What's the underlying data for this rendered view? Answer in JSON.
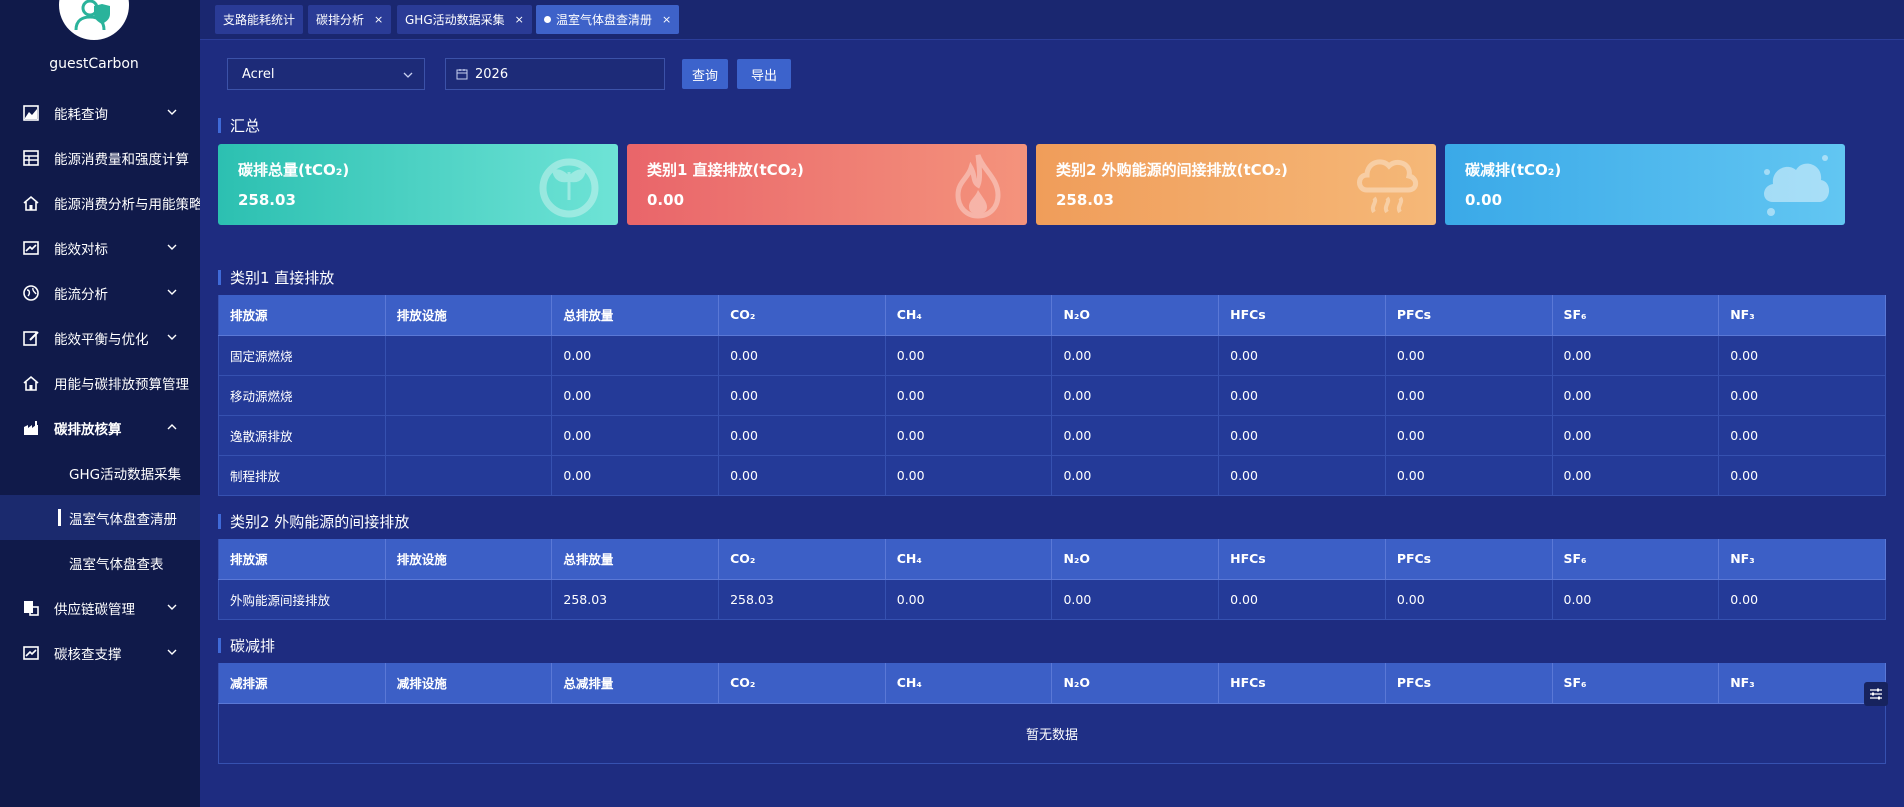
{
  "user": {
    "name": "guestCarbon"
  },
  "menu": [
    {
      "label": "能耗查询",
      "icon": "chart-area-icon",
      "has_chevron": true
    },
    {
      "label": "能源消费量和强度计算",
      "icon": "table-icon",
      "has_chevron": false
    },
    {
      "label": "能源消费分析与用能策略",
      "icon": "home-icon",
      "has_chevron": false
    },
    {
      "label": "能效对标",
      "icon": "trend-icon",
      "has_chevron": true
    },
    {
      "label": "能流分析",
      "icon": "globe-icon",
      "has_chevron": true
    },
    {
      "label": "能效平衡与优化",
      "icon": "edit-icon",
      "has_chevron": true
    },
    {
      "label": "用能与碳排放预算管理",
      "icon": "home-icon",
      "has_chevron": false
    },
    {
      "label": "碳排放核算",
      "icon": "factory-icon",
      "has_chevron": true
    }
  ],
  "submenu": [
    {
      "label": "GHG活动数据采集"
    },
    {
      "label": "温室气体盘查清册"
    },
    {
      "label": "温室气体盘查表"
    }
  ],
  "menu_bottom": [
    {
      "label": "供应链碳管理",
      "icon": "supply-chain-icon"
    },
    {
      "label": "碳核查支撑",
      "icon": "trend-icon"
    }
  ],
  "tabs": [
    {
      "label": "支路能耗统计",
      "closable": false
    },
    {
      "label": "碳排分析",
      "closable": true
    },
    {
      "label": "GHG活动数据采集",
      "closable": true
    },
    {
      "label": "温室气体盘查清册",
      "closable": true,
      "active": true
    }
  ],
  "tab_close_glyph": "×",
  "filters": {
    "org": "Acrel",
    "year": "2026",
    "query_label": "查询",
    "export_label": "导出"
  },
  "summary": {
    "title": "汇总",
    "cards": [
      {
        "title": "碳排总量(tCO₂)",
        "value": "258.03"
      },
      {
        "title": "类别1 直接排放(tCO₂)",
        "value": "0.00"
      },
      {
        "title": "类别2 外购能源的间接排放(tCO₂)",
        "value": "258.03"
      },
      {
        "title": "碳减排(tCO₂)",
        "value": "0.00"
      }
    ]
  },
  "cat1": {
    "title": "类别1 直接排放",
    "headers": [
      "排放源",
      "排放设施",
      "总排放量",
      "CO₂",
      "CH₄",
      "N₂O",
      "HFCs",
      "PFCs",
      "SF₆",
      "NF₃"
    ],
    "rows": [
      [
        "固定源燃烧",
        "",
        "0.00",
        "0.00",
        "0.00",
        "0.00",
        "0.00",
        "0.00",
        "0.00",
        "0.00"
      ],
      [
        "移动源燃烧",
        "",
        "0.00",
        "0.00",
        "0.00",
        "0.00",
        "0.00",
        "0.00",
        "0.00",
        "0.00"
      ],
      [
        "逸散源排放",
        "",
        "0.00",
        "0.00",
        "0.00",
        "0.00",
        "0.00",
        "0.00",
        "0.00",
        "0.00"
      ],
      [
        "制程排放",
        "",
        "0.00",
        "0.00",
        "0.00",
        "0.00",
        "0.00",
        "0.00",
        "0.00",
        "0.00"
      ]
    ]
  },
  "cat2": {
    "title": "类别2 外购能源的间接排放",
    "headers": [
      "排放源",
      "排放设施",
      "总排放量",
      "CO₂",
      "CH₄",
      "N₂O",
      "HFCs",
      "PFCs",
      "SF₆",
      "NF₃"
    ],
    "rows": [
      [
        "外购能源间接排放",
        "",
        "258.03",
        "258.03",
        "0.00",
        "0.00",
        "0.00",
        "0.00",
        "0.00",
        "0.00"
      ]
    ]
  },
  "reduction": {
    "title": "碳减排",
    "headers": [
      "减排源",
      "减排设施",
      "总减排量",
      "CO₂",
      "CH₄",
      "N₂O",
      "HFCs",
      "PFCs",
      "SF₆",
      "NF₃"
    ],
    "empty_text": "暂无数据"
  }
}
